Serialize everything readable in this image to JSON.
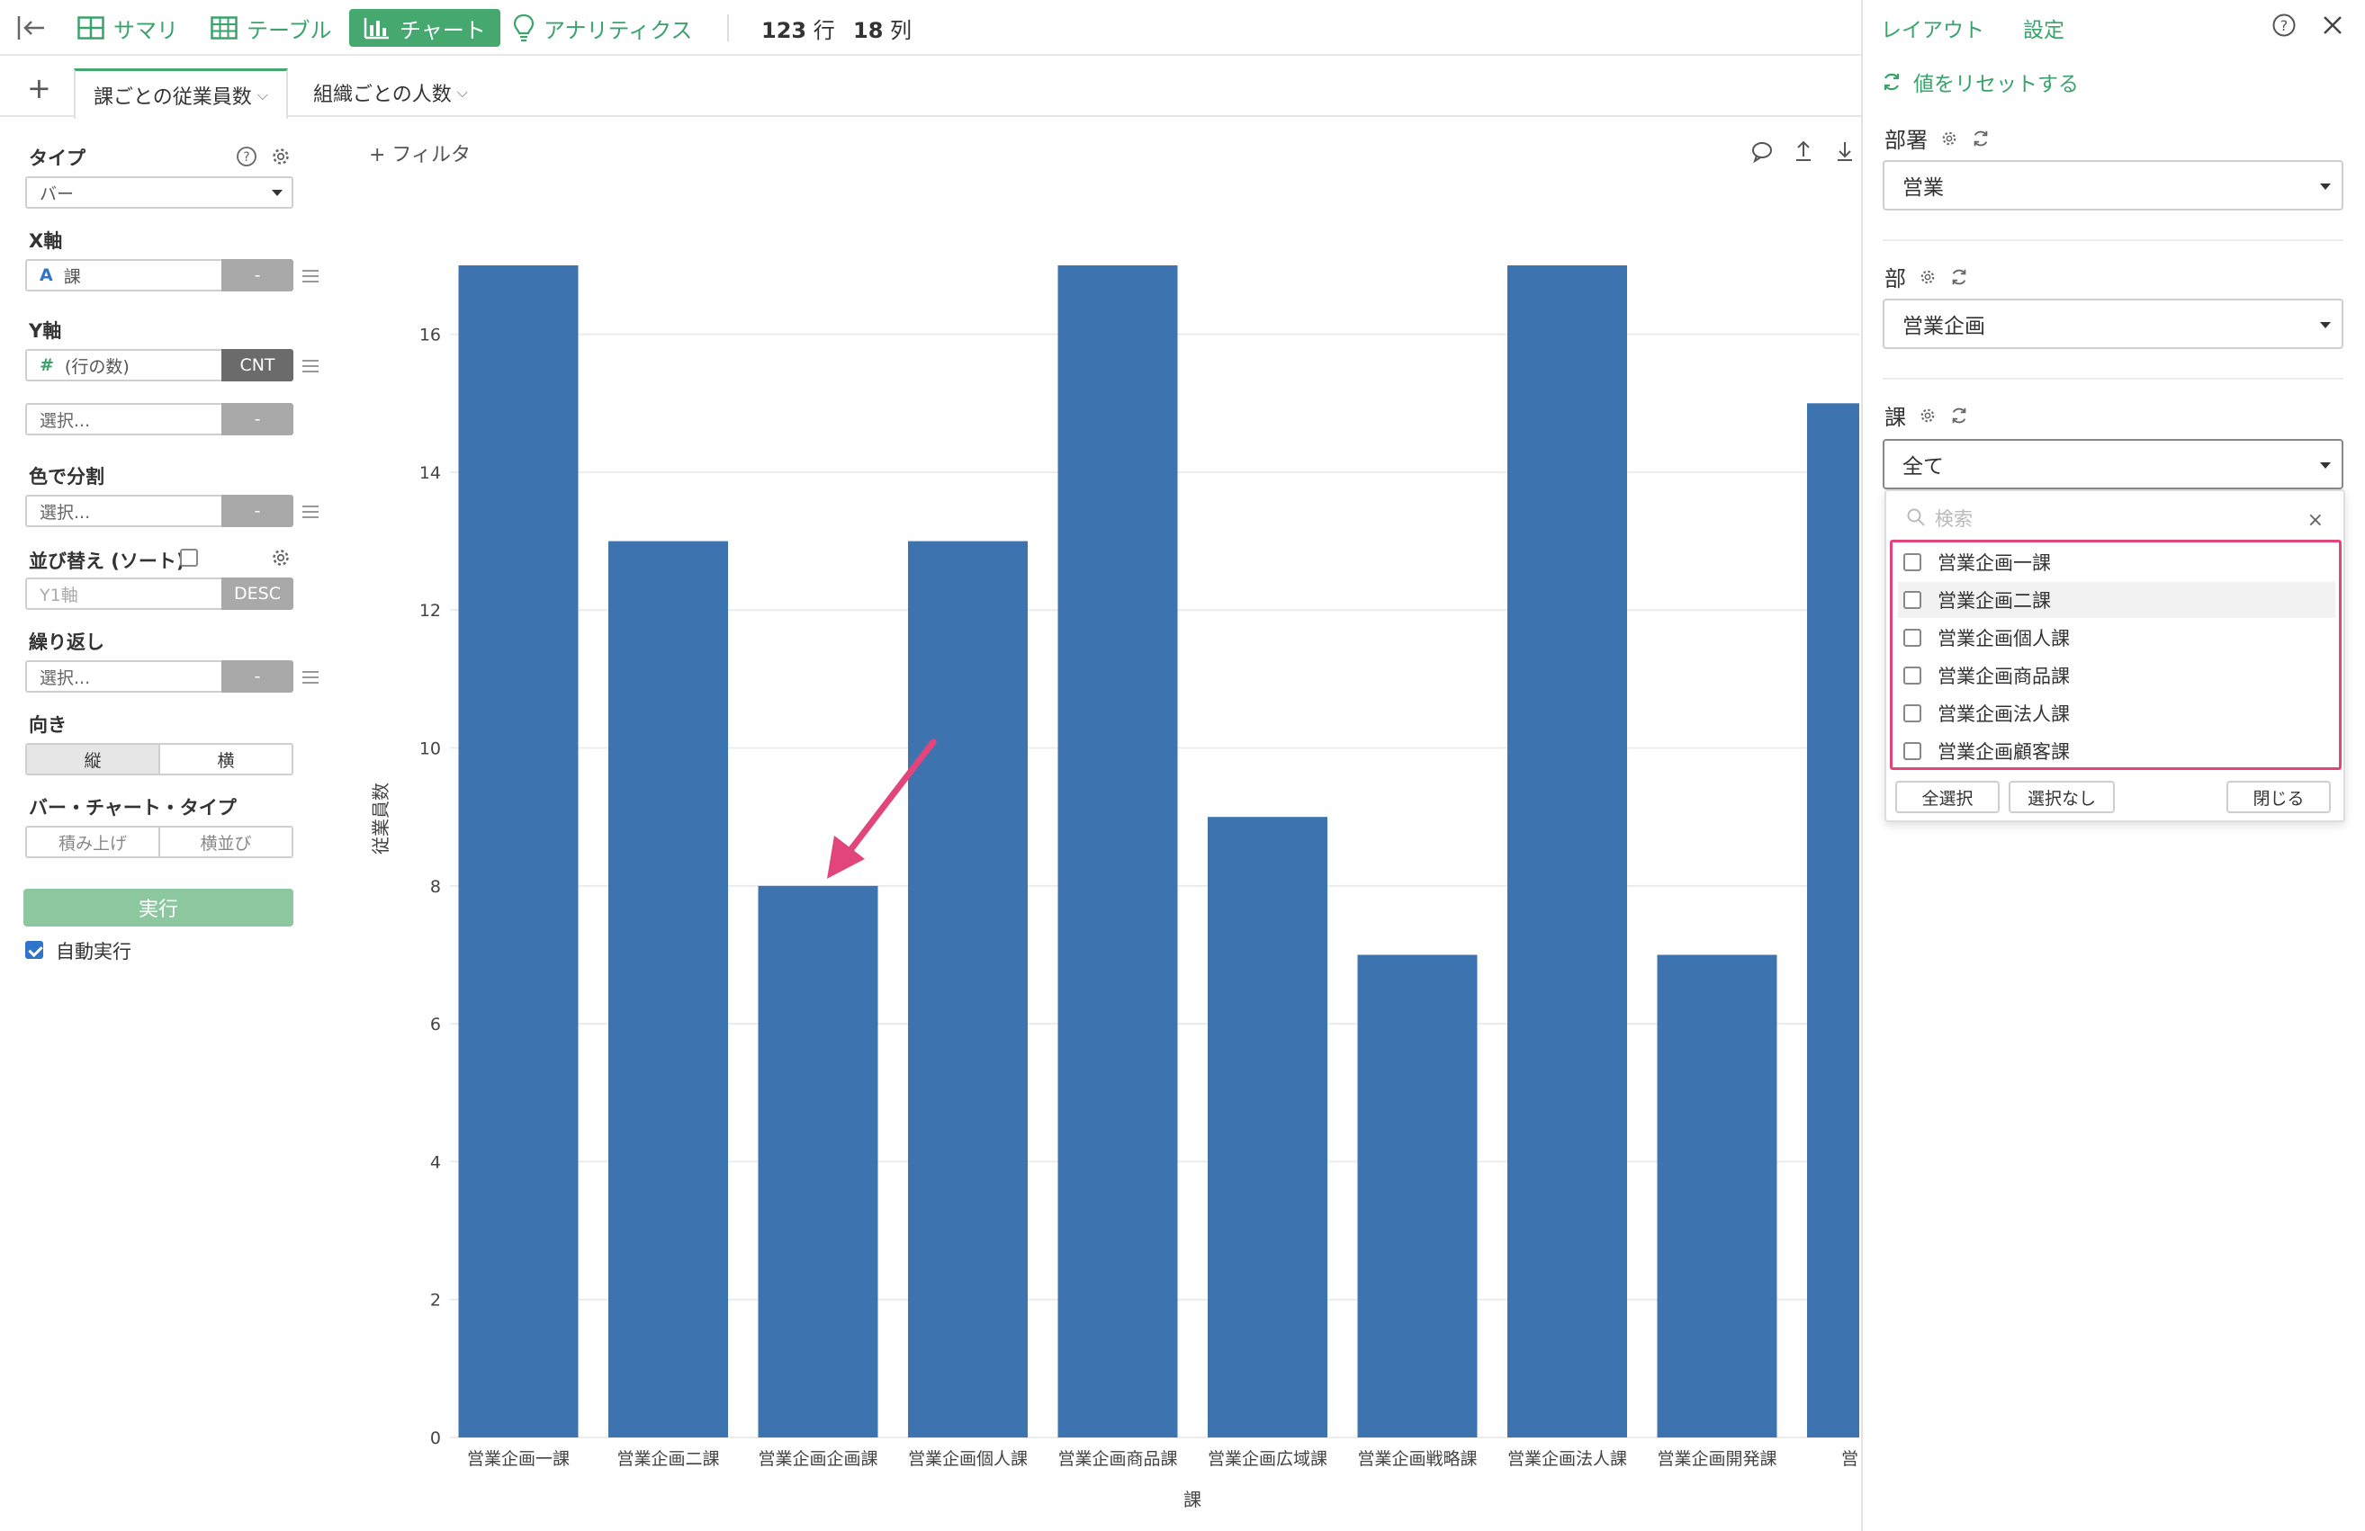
{
  "toolbar": {
    "items": [
      {
        "label": "サマリ",
        "icon": "summary-grid-icon"
      },
      {
        "label": "テーブル",
        "icon": "table-icon"
      },
      {
        "label": "チャート",
        "icon": "bar-chart-icon"
      },
      {
        "label": "アナリティクス",
        "icon": "lightbulb-icon"
      }
    ],
    "rows_value": "123",
    "rows_unit": "行",
    "cols_value": "18",
    "cols_unit": "列"
  },
  "tabs": [
    {
      "label": "課ごとの従業員数"
    },
    {
      "label": "組織ごとの人数"
    }
  ],
  "left_panel": {
    "type_label": "タイプ",
    "type_value": "バー",
    "x_label": "X軸",
    "x_icon_glyph": "A",
    "x_value": "課",
    "x_btn": "-",
    "y_label": "Y軸",
    "y_icon_glyph": "#",
    "y_value": "(行の数)",
    "y_btn": "CNT",
    "y2_placeholder": "選択...",
    "y2_btn": "-",
    "color_label": "色で分割",
    "color_placeholder": "選択...",
    "color_btn": "-",
    "sort_label": "並び替え (ソート)",
    "sort_value": "Y1軸",
    "sort_btn": "DESC",
    "repeat_label": "繰り返し",
    "repeat_placeholder": "選択...",
    "repeat_btn": "-",
    "orient_label": "向き",
    "orient_options": [
      "縦",
      "横"
    ],
    "bartype_label": "バー・チャート・タイプ",
    "bartype_options": [
      "積み上げ",
      "横並び"
    ],
    "run_label": "実行",
    "auto_run_label": "自動実行",
    "auto_run_checked": true
  },
  "chart_toolbar": {
    "filter_label": "+ フィルタ"
  },
  "chart_data": {
    "type": "bar",
    "categories": [
      "営業企画一課",
      "営業企画二課",
      "営業企画企画課",
      "営業企画個人課",
      "営業企画商品課",
      "営業企画広域課",
      "営業企画戦略課",
      "営業企画法人課",
      "営業企画開発課",
      "営業企"
    ],
    "values": [
      17,
      13,
      8,
      13,
      17,
      9,
      7,
      17,
      7,
      15
    ],
    "xlabel": "課",
    "ylabel": "従業員数",
    "ylim": [
      0,
      17
    ],
    "yticks": [
      0,
      2,
      4,
      6,
      8,
      10,
      12,
      14,
      16
    ],
    "bar_color": "#3d74b0",
    "grid": true,
    "annotation": {
      "type": "arrow",
      "target_category": "営業企画企画課",
      "color": "#e2447c"
    }
  },
  "right_panel": {
    "tab_layout": "レイアウト",
    "tab_settings": "設定",
    "reset_label": "値をリセットする",
    "dept_label": "部署",
    "dept_value": "営業",
    "bu_label": "部",
    "bu_value": "営業企画",
    "ka_label": "課",
    "ka_value": "全て",
    "search_placeholder": "検索",
    "options": [
      "営業企画一課",
      "営業企画二課",
      "営業企画個人課",
      "営業企画商品課",
      "営業企画法人課",
      "営業企画顧客課"
    ],
    "select_all": "全選択",
    "select_none": "選択なし",
    "close": "閉じる",
    "highlight_color": "#e2447c",
    "accent_color": "#3aa36b"
  }
}
